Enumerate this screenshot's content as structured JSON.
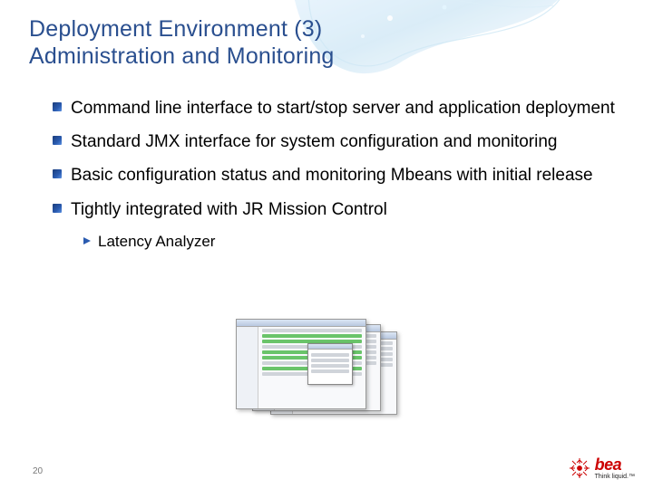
{
  "title_line1": "Deployment Environment (3)",
  "title_line2": "Administration and Monitoring",
  "bullets": [
    "Command line interface to start/stop server and application deployment",
    "Standard JMX interface for system configuration and monitoring",
    "Basic configuration status and monitoring Mbeans with initial release",
    "Tightly integrated with JR Mission Control"
  ],
  "sub_bullets": [
    "Latency Analyzer"
  ],
  "page_number": "20",
  "logo": {
    "brand": "bea",
    "tagline": "Think liquid.™"
  }
}
